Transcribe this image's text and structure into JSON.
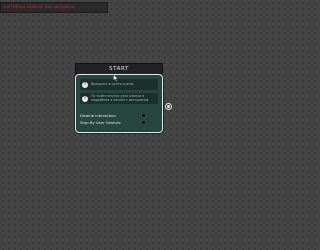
{
  "error_bar": {
    "text": "ыз?ябяы ирвзяг вы зыярвыя"
  },
  "node": {
    "title": "START",
    "messages": [
      {
        "icon": "info-icon",
        "text": "Вращаясь в центр сцены."
      },
      {
        "icon": "info-icon",
        "text": "По тыйте внутри узла кнопки и подробнее о начале с ресторанов."
      }
    ],
    "options": [
      {
        "label": "Disable Interaction",
        "checked": false
      },
      {
        "label": "Stop By User Gesture",
        "checked": false
      }
    ]
  },
  "colors": {
    "canvas": "#454545",
    "node_body": "#27463f",
    "node_border": "#dfe7e4",
    "error_text": "#d32020"
  }
}
